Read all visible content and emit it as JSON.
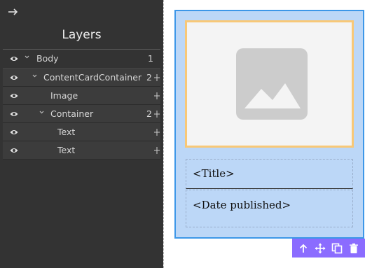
{
  "panel": {
    "title": "Layers",
    "collapse_icon": "arrow-right-icon"
  },
  "layers": [
    {
      "name": "Body",
      "count": "1",
      "indent": 0,
      "expanded": true
    },
    {
      "name": "ContentCardContainer",
      "count": "2",
      "indent": 1,
      "expanded": true
    },
    {
      "name": "Image",
      "count": "",
      "indent": 2,
      "expanded": false
    },
    {
      "name": "Container",
      "count": "2",
      "indent": 2,
      "expanded": true
    },
    {
      "name": "Text",
      "count": "",
      "indent": 3,
      "expanded": false
    },
    {
      "name": "Text",
      "count": "",
      "indent": 3,
      "expanded": false
    }
  ],
  "canvas": {
    "image_placeholder_icon": "image-placeholder-icon",
    "title_text": "<Title>",
    "date_text": "<Date published>"
  },
  "toolbar": {
    "icons": [
      "arrow-up-icon",
      "move-icon",
      "copy-icon",
      "trash-icon"
    ]
  },
  "colors": {
    "panel_bg": "#333333",
    "selection_border": "#3d97e8",
    "selection_fill": "#bcd7f7",
    "image_border": "#f8c877",
    "toolbar_bg": "#8b6cff"
  }
}
